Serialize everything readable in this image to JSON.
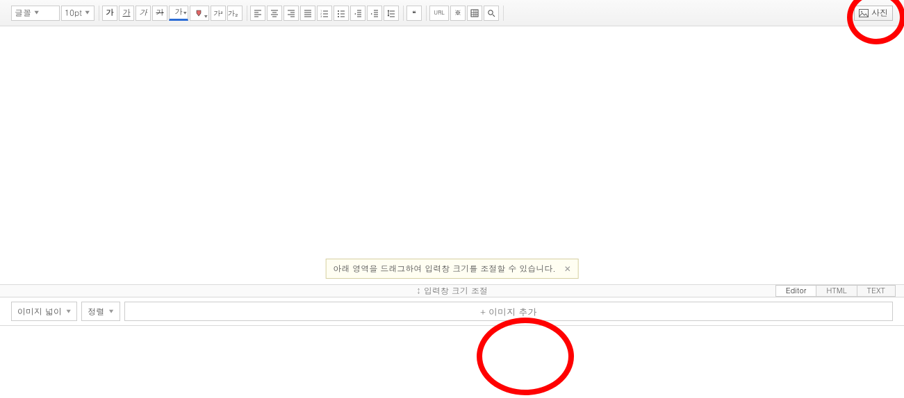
{
  "toolbar": {
    "font_family": "글꼴",
    "font_size": "10pt",
    "bold": "가",
    "italic": "가",
    "underline": "가",
    "strike": "가",
    "fontcolor": "가",
    "bgcolor_icon": "bgcolor",
    "sup": "가²",
    "sub": "가₂",
    "quote": "❝",
    "url": "URL",
    "special": "※",
    "table_icon": "table",
    "find_icon": "search",
    "photo_label": "사진"
  },
  "body": {
    "resize_tooltip": "아래 영역을 드래그하여 입력창 크기를 조절할 수 있습니다.",
    "resize_bar_label": "입력창 크기 조절"
  },
  "mode_tabs": {
    "editor": "Editor",
    "html": "HTML",
    "text": "TEXT"
  },
  "bottom": {
    "image_width": "이미지 넓이",
    "align": "정렬",
    "add_image": "+ 이미지 추가"
  }
}
